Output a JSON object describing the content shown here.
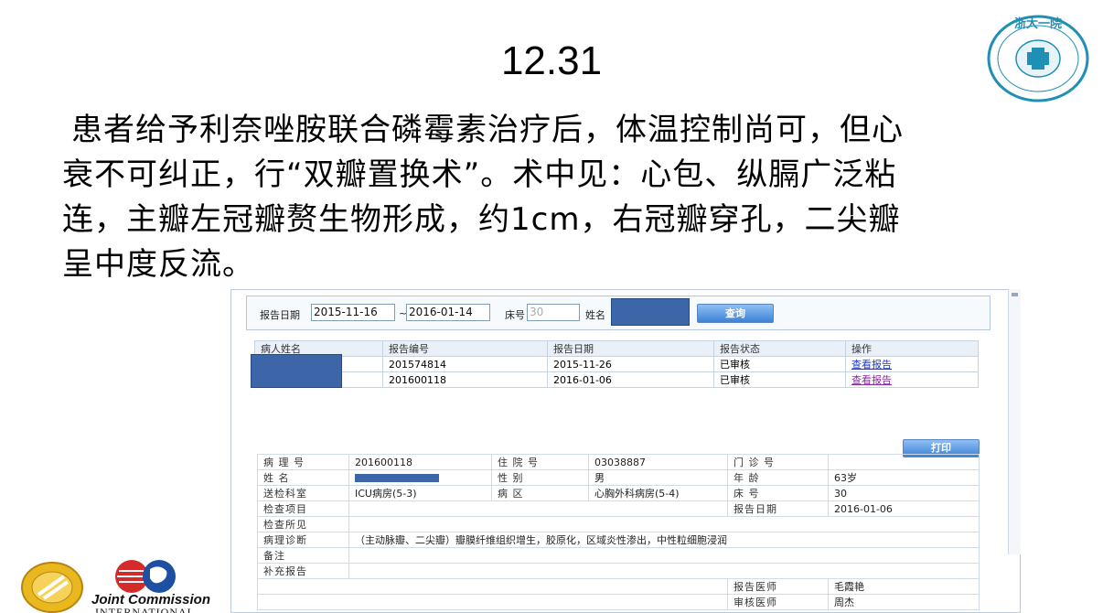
{
  "slide": {
    "title": "12.31",
    "body_lines": [
      "患者给予利奈唑胺联合磷霉素治疗后，体温控制尚可，但心",
      "衰不可纠正，行“双瓣置换术”。术中见：心包、纵膈广泛粘",
      "连，主瓣左冠瓣赘生物形成，约1cm，右冠瓣穿孔，二尖瓣",
      "呈中度反流。"
    ],
    "seal_text": "浙大一院",
    "logo_text": "Joint Commission",
    "logo_sub": "INTERNATIONAL"
  },
  "search": {
    "date_label": "报告日期",
    "date_from": "2015-11-16",
    "date_sep": "~",
    "date_to": "2016-01-14",
    "bed_label": "床号",
    "bed_placeholder": "30",
    "name_label": "姓名",
    "query_button": "查询"
  },
  "results": {
    "headers": [
      "病人姓名",
      "报告编号",
      "报告日期",
      "报告状态",
      "操作"
    ],
    "rows": [
      {
        "id": "201574814",
        "date": "2015-11-26",
        "status": "已审核",
        "action": "查看报告"
      },
      {
        "id": "201600118",
        "date": "2016-01-06",
        "status": "已审核",
        "action": "查看报告"
      }
    ]
  },
  "report": {
    "print_button": "打印",
    "pathology_no_label": "病 理 号",
    "pathology_no": "201600118",
    "inpatient_no_label": "住 院 号",
    "inpatient_no": "03038887",
    "outpatient_no_label": "门 诊 号",
    "outpatient_no": "",
    "name_label": "姓 名",
    "gender_label": "性 别",
    "gender": "男",
    "age_label": "年 龄",
    "age": "63岁",
    "dept_label": "送检科室",
    "dept": "ICU病房(5-3)",
    "ward_label": "病 区",
    "ward": "心胸外科病房(5-4)",
    "bed_label": "床 号",
    "bed": "30",
    "item_label": "检查项目",
    "report_date_label": "报告日期",
    "report_date": "2016-01-06",
    "findings_label": "检查所见",
    "diagnosis_label": "病理诊断",
    "diagnosis": "（主动脉瓣、二尖瓣）瓣膜纤维组织增生，胶原化，区域炎性渗出，中性粒细胞浸润",
    "remark_label": "备注",
    "supplement_label": "补充报告",
    "doctor_label": "报告医师",
    "doctor": "毛霞艳",
    "reviewer_label": "审核医师",
    "reviewer": "周杰"
  },
  "colors": {
    "accent": "#3d82d6",
    "redaction": "#3d66a8",
    "link": "#1a3ad0"
  }
}
